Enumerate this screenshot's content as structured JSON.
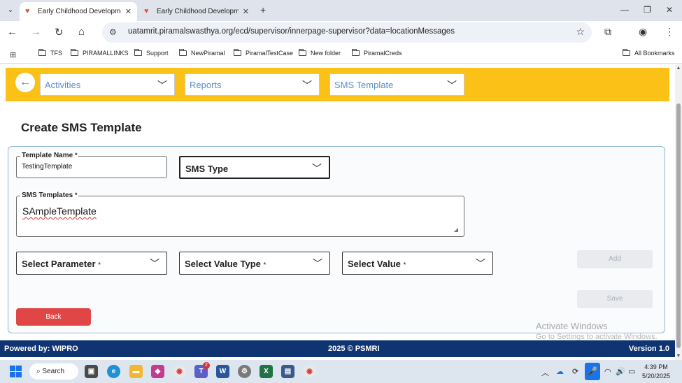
{
  "browser": {
    "tabs": [
      {
        "title": "Early Childhood Developmen",
        "active": true
      },
      {
        "title": "Early Childhood Developmen",
        "active": false
      }
    ],
    "url": "uatamrit.piramalswasthya.org/ecd/supervisor/innerpage-supervisor?data=locationMessages",
    "bookmarks": [
      "TFS",
      "PIRAMALLINKS",
      "Support",
      "NewPiramal",
      "PiramalTestCase",
      "New folder",
      "PiramalCreds"
    ],
    "all_bookmarks": "All Bookmarks"
  },
  "nav": {
    "activities": "Activities",
    "reports": "Reports",
    "sms_template": "SMS Template"
  },
  "page": {
    "title": "Create SMS Template"
  },
  "form": {
    "template_name_label": "Template Name",
    "template_name_value": "TestingTemplate",
    "sms_type_label": "SMS Type",
    "sms_templates_label": "SMS Templates",
    "sms_templates_value": "SAmpleTemplate",
    "select_parameter": "Select Parameter",
    "select_value_type": "Select Value Type",
    "select_value": "Select Value",
    "required_mark": "*",
    "add_label": "Add",
    "save_label": "Save",
    "back_label": "Back"
  },
  "watermark": {
    "line1": "Activate Windows",
    "line2": "Go to Settings to activate Windows."
  },
  "footer": {
    "left": "Powered by: WIPRO",
    "center": "2025 © PSMRI",
    "right": "Version 1.0"
  },
  "taskbar": {
    "search_label": "Search",
    "teams_badge": "2",
    "time": "4:39 PM",
    "date": "5/20/2025"
  },
  "colors": {
    "nav_bar": "#fbc117",
    "footer": "#0f3472",
    "back_button": "#e04646",
    "nav_text": "#5a8fc7"
  }
}
